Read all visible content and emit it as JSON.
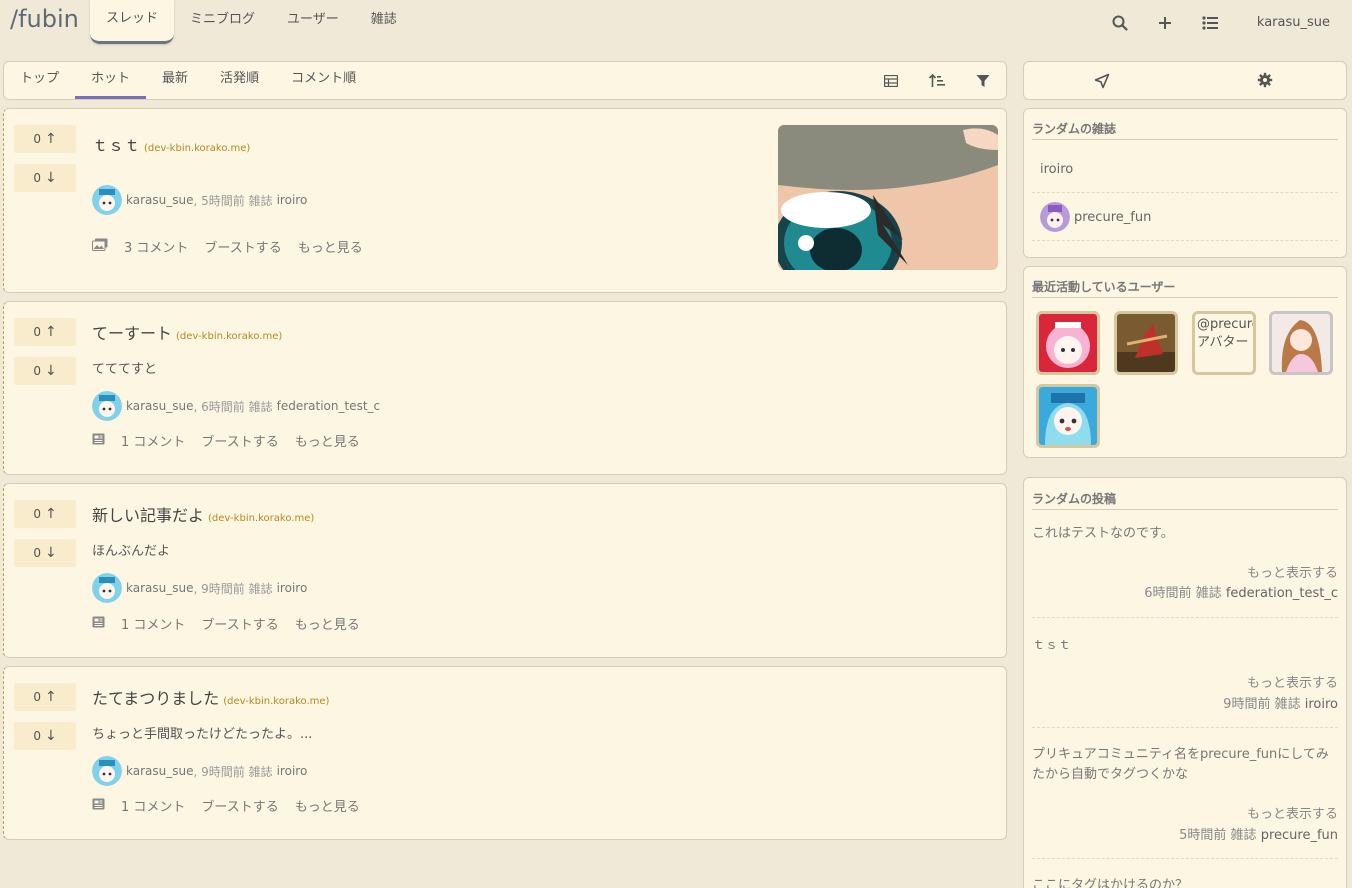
{
  "brand": "/fubin",
  "nav": {
    "tabs": [
      {
        "label": "スレッド",
        "active": true
      },
      {
        "label": "ミニブログ"
      },
      {
        "label": "ユーザー"
      },
      {
        "label": "雑誌"
      }
    ],
    "icons": [
      "search-icon",
      "plus-icon",
      "list-icon"
    ],
    "username": "karasu_sue"
  },
  "subnav": {
    "tabs": [
      {
        "label": "トップ"
      },
      {
        "label": "ホット",
        "active": true
      },
      {
        "label": "最新"
      },
      {
        "label": "活発順"
      },
      {
        "label": "コメント順"
      }
    ],
    "icons": [
      "table-icon",
      "sort-icon",
      "filter-icon"
    ]
  },
  "entries": [
    {
      "up": "0",
      "down": "0",
      "title": "ｔｓｔ",
      "domain": "(dev-kbin.korako.me)",
      "body": "",
      "user": "karasu_sue",
      "time": ", 5時間前",
      "mag_prefix": "雑誌",
      "magazine": "iroiro",
      "comments": "3 コメント",
      "boost": "ブーストする",
      "more": "もっと見る",
      "icon": "gallery-icon",
      "has_thumb": true
    },
    {
      "up": "0",
      "down": "0",
      "title": "てーすート",
      "domain": "(dev-kbin.korako.me)",
      "body": "てててすと",
      "user": "karasu_sue",
      "time": ", 6時間前",
      "mag_prefix": "雑誌",
      "magazine": "federation_test_c",
      "comments": "1 コメント",
      "boost": "ブーストする",
      "more": "もっと見る",
      "icon": "article-icon"
    },
    {
      "up": "0",
      "down": "0",
      "title": "新しい記事だよ",
      "domain": "(dev-kbin.korako.me)",
      "body": "ほんぶんだよ",
      "user": "karasu_sue",
      "time": ", 9時間前",
      "mag_prefix": "雑誌",
      "magazine": "iroiro",
      "comments": "1 コメント",
      "boost": "ブーストする",
      "more": "もっと見る",
      "icon": "article-icon"
    },
    {
      "up": "0",
      "down": "0",
      "title": "たてまつりました",
      "domain": "(dev-kbin.korako.me)",
      "body": "ちょっと手間取ったけどたったよ。...",
      "user": "karasu_sue",
      "time": ", 9時間前",
      "mag_prefix": "雑誌",
      "magazine": "iroiro",
      "comments": "1 コメント",
      "boost": "ブーストする",
      "more": "もっと見る",
      "icon": "article-icon"
    }
  ],
  "sidebar": {
    "toolbar_icons": [
      "send-icon",
      "gear-icon"
    ],
    "random_magazines": {
      "heading": "ランダムの雑誌",
      "items": [
        "iroiro",
        "precure_fun"
      ]
    },
    "active_users": {
      "heading": "最近活動しているユーザー",
      "broken_alt": "@precure アバター"
    },
    "random_posts": {
      "heading": "ランダムの投稿",
      "items": [
        {
          "text": "これはテストなのです。",
          "more": "もっと表示する",
          "time": "6時間前",
          "mag_prefix": "雑誌",
          "magazine": "federation_test_c"
        },
        {
          "text": "ｔｓｔ",
          "more": "もっと表示する",
          "time": "9時間前",
          "mag_prefix": "雑誌",
          "magazine": "iroiro"
        },
        {
          "text": "プリキュアコミュニティ名をprecure_funにしてみたから自動でタグつくかな",
          "more": "もっと表示する",
          "time": "5時間前",
          "mag_prefix": "雑誌",
          "magazine": "precure_fun"
        },
        {
          "text": "ここにタグはかけるのか？"
        }
      ]
    }
  },
  "colors": {
    "background": "#f0e9d8",
    "card": "#fdf6e3",
    "accent": "#7b6fb8",
    "domain": "#b38a1f"
  }
}
